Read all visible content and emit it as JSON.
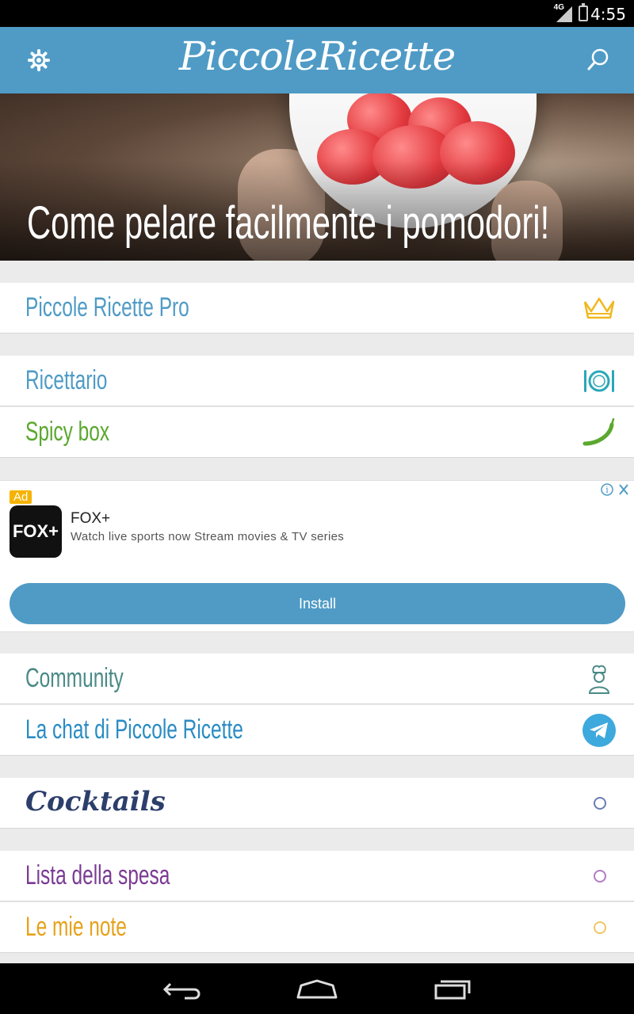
{
  "status": {
    "network": "4G",
    "time": "4:55"
  },
  "appbar": {
    "title": "PiccoleRicette"
  },
  "hero": {
    "caption": "Come pelare facilmente i pomodori!"
  },
  "menu": {
    "pro": {
      "label": "Piccole Ricette Pro",
      "color": "#4f9bc6",
      "icon": "crown-icon"
    },
    "ricettario": {
      "label": "Ricettario",
      "color": "#4f9bc6",
      "icon": "plate-cutlery-icon"
    },
    "spicy": {
      "label": "Spicy box",
      "color": "#5aa82e",
      "icon": "chili-pepper-icon"
    },
    "community": {
      "label": "Community",
      "color": "#4a8a86",
      "icon": "chef-icon"
    },
    "chat": {
      "label": "La chat di Piccole Ricette",
      "color": "#2a8cc4",
      "icon": "telegram-icon"
    },
    "cocktails": {
      "label": "Cocktails",
      "color": "#2c3e6b",
      "icon": "circle-icon"
    },
    "lista": {
      "label": "Lista della spesa",
      "color": "#7a3b93",
      "icon": "circle-icon"
    },
    "note": {
      "label": "Le mie note",
      "color": "#e6a21a",
      "icon": "circle-icon"
    }
  },
  "ad": {
    "badge": "Ad",
    "app_logo_text": "FOX+",
    "title": "FOX+",
    "description": "Watch live sports now Stream movies & TV series",
    "install": "Install"
  }
}
